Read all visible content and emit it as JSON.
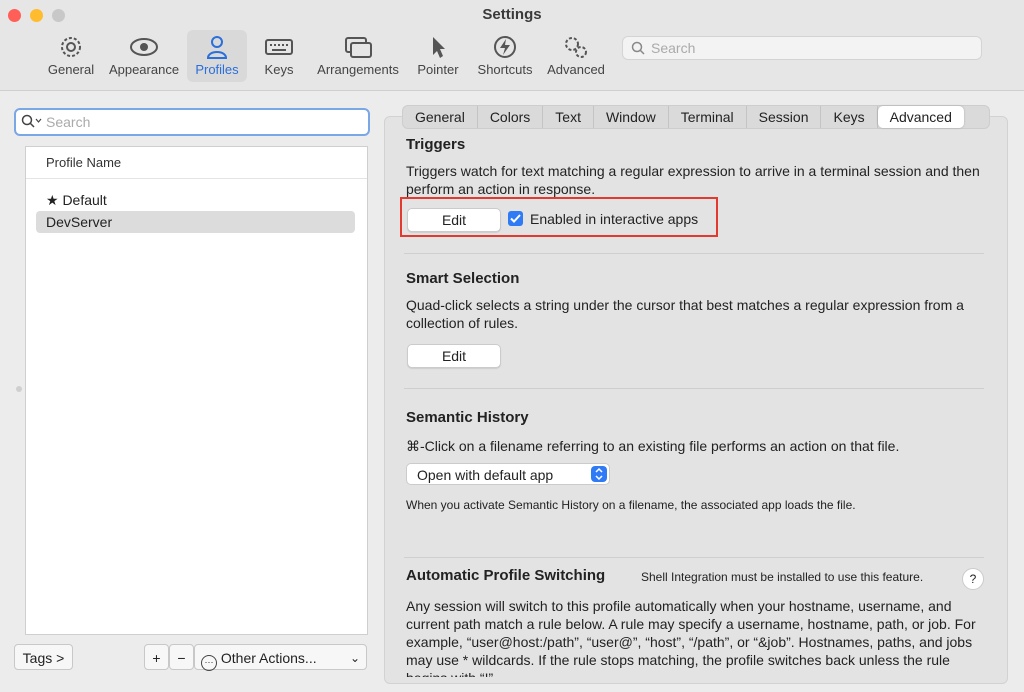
{
  "window": {
    "title": "Settings"
  },
  "toolbar": {
    "items": [
      {
        "label": "General",
        "icon": "gear-icon"
      },
      {
        "label": "Appearance",
        "icon": "eye-icon"
      },
      {
        "label": "Profiles",
        "icon": "person-icon"
      },
      {
        "label": "Keys",
        "icon": "keyboard-icon"
      },
      {
        "label": "Arrangements",
        "icon": "windows-icon"
      },
      {
        "label": "Pointer",
        "icon": "pointer-icon"
      },
      {
        "label": "Shortcuts",
        "icon": "bolt-icon"
      },
      {
        "label": "Advanced",
        "icon": "gears-icon"
      }
    ],
    "active": "Profiles",
    "search_placeholder": "Search"
  },
  "profiles": {
    "search_placeholder": "Search",
    "column_header": "Profile Name",
    "items": [
      {
        "label": "★ Default",
        "selected": false
      },
      {
        "label": "DevServer",
        "selected": true
      }
    ],
    "tags_button": "Tags >",
    "add_button": "+",
    "remove_button": "−",
    "other_actions": "Other Actions..."
  },
  "tabs": [
    "General",
    "Colors",
    "Text",
    "Window",
    "Terminal",
    "Session",
    "Keys",
    "Advanced"
  ],
  "active_tab": "Advanced",
  "triggers": {
    "title": "Triggers",
    "description": "Triggers watch for text matching a regular expression to arrive in a terminal session and then perform an action in response.",
    "edit_label": "Edit",
    "checkbox_label": "Enabled in interactive apps",
    "checkbox_checked": true
  },
  "smart_selection": {
    "title": "Smart Selection",
    "description": "Quad-click selects a string under the cursor that best matches a regular expression from a collection of rules.",
    "edit_label": "Edit"
  },
  "semantic_history": {
    "title": "Semantic History",
    "description": "⌘-Click on a filename referring to an existing file performs an action on that file.",
    "select_value": "Open with default app",
    "note": "When you activate Semantic History on a filename, the associated app loads the file."
  },
  "auto_switching": {
    "title": "Automatic Profile Switching",
    "note": "Shell Integration must be installed to use this feature.",
    "help": "?",
    "description": "Any session will switch to this profile automatically when your hostname, username, and current path match a rule below. A rule may specify a username, hostname, path, or job. For example, “user@host:/path”, “user@”, “host”, “/path”, or “&job”. Hostnames, paths, and jobs may use * wildcards. If the rule stops matching, the profile switches back unless the rule begins with “!”."
  },
  "colors": {
    "accent": "#2f7bf6",
    "highlight": "#e23a2e"
  }
}
